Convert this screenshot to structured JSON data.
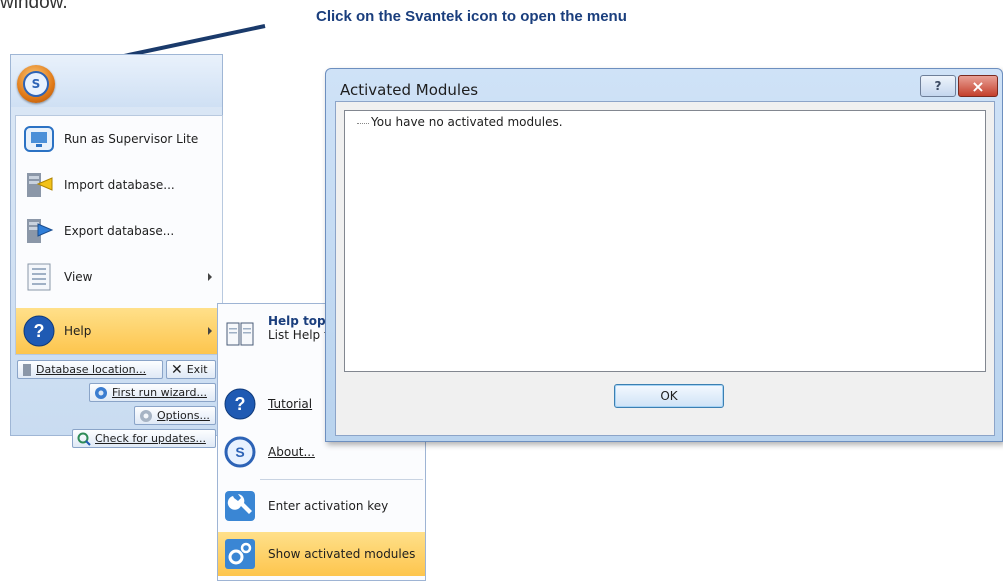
{
  "caption": "Click on the Svantek icon to open the menu",
  "top_fragment": "window.",
  "app_menu": {
    "items": [
      {
        "label": "Run as Supervisor Lite",
        "icon": "monitor-icon"
      },
      {
        "label": "Import database...",
        "icon": "import-database-icon"
      },
      {
        "label": "Export database...",
        "icon": "export-database-icon"
      },
      {
        "label": "View",
        "icon": "view-icon"
      },
      {
        "label": "Help",
        "icon": "help-icon"
      }
    ],
    "database_location": "Database location...",
    "exit": "Exit",
    "first_run_wizard": "First run wizard...",
    "options": "Options...",
    "check_updates": "Check for updates..."
  },
  "help_submenu": {
    "help_topics_title": "Help topi",
    "help_topics_desc": "List Help t",
    "tutorial": "Tutorial",
    "about": "About...",
    "enter_key": "Enter activation key",
    "show_modules": "Show activated modules"
  },
  "dialog": {
    "title": "Activated Modules",
    "help_glyph": "?",
    "close_glyph": "×",
    "tree_message": "You have no activated modules.",
    "ok_label": "OK"
  },
  "colors": {
    "caption": "#1a3e7d",
    "arrow": "#1a3a6b",
    "highlight": "#fdc54d"
  }
}
